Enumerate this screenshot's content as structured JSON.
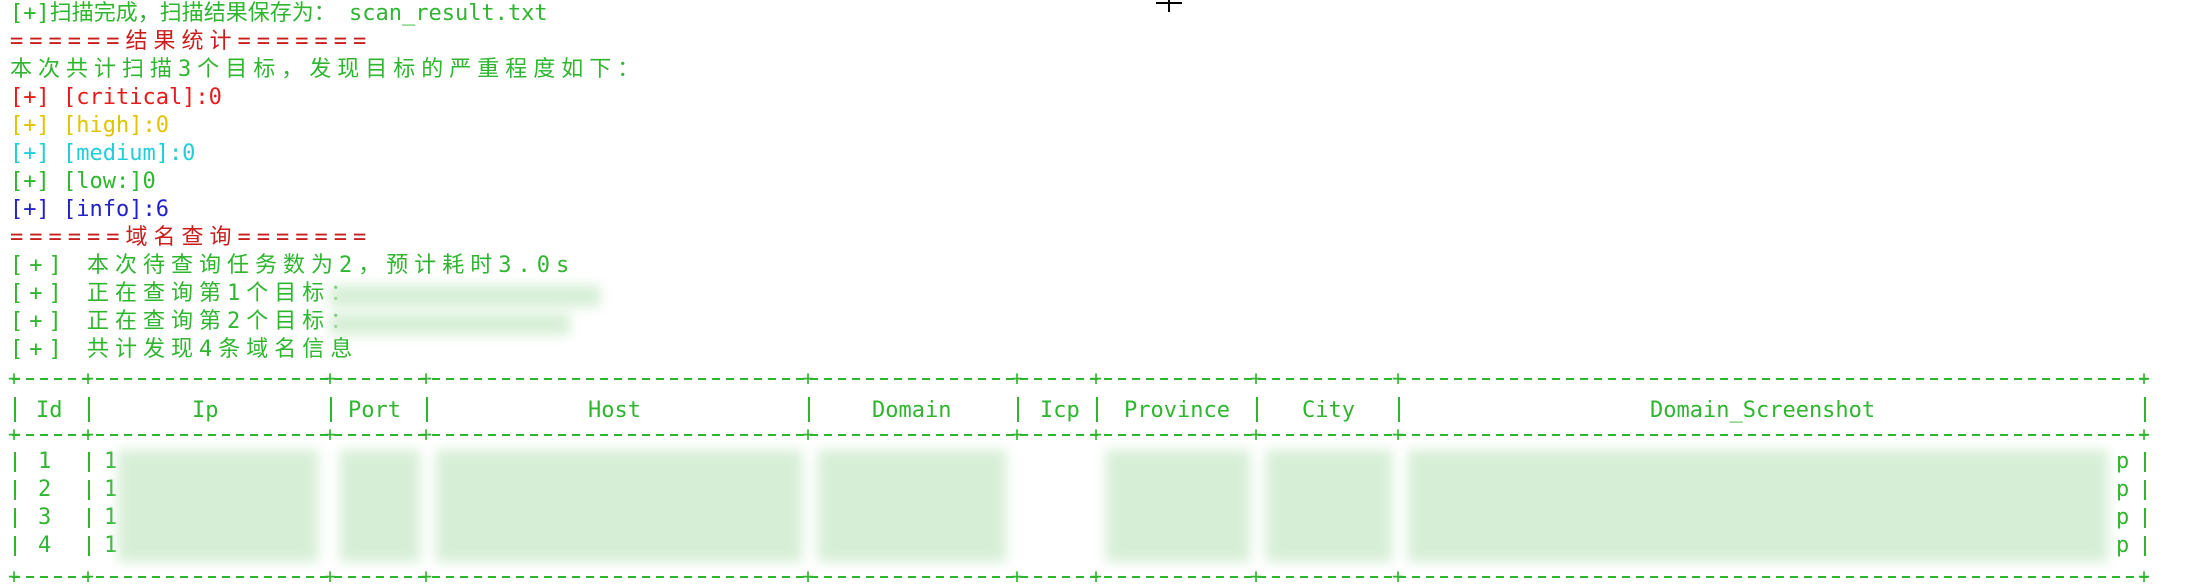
{
  "lines": {
    "scan_done": "[+]扫描完成，扫描结果保存为： scan_result.txt",
    "stats_header": "======结果统计=======",
    "stats_intro": "本次共计扫描3个目标，发现目标的严重程度如下：",
    "critical": "[+] [critical]:0",
    "high": "[+] [high]:0",
    "medium": "[+] [medium]:0",
    "low": "[+] [low:]0",
    "info": "[+] [info]:6",
    "domain_header": "======域名查询=======",
    "task_count": "[+] 本次待查询任务数为2，预计耗时3.0s",
    "query1": "[+] 正在查询第1个目标：",
    "query2": "[+] 正在查询第2个目标：",
    "found": "[+] 共计发现4条域名信息"
  },
  "table": {
    "border": "+----+----------------+------+------------------------------+--------------+------+------------+------------+--------------------------------------------------------+",
    "headers": [
      "Id",
      "Ip",
      "Port",
      "Host",
      "Domain",
      "Icp",
      "Province",
      "City",
      "Domain_Screenshot"
    ],
    "rows": [
      {
        "id": "1",
        "ip_start": "1",
        "end": "p"
      },
      {
        "id": "2",
        "ip_start": "1",
        "end": "p"
      },
      {
        "id": "3",
        "ip_start": "1",
        "end": "p"
      },
      {
        "id": "4",
        "ip_start": "1",
        "end": "p"
      }
    ]
  },
  "colors": {
    "green": "#2fb52f",
    "red": "#c81e1e",
    "yellow": "#e0c400",
    "cyan": "#1fcfd8",
    "blue": "#2222c8"
  }
}
